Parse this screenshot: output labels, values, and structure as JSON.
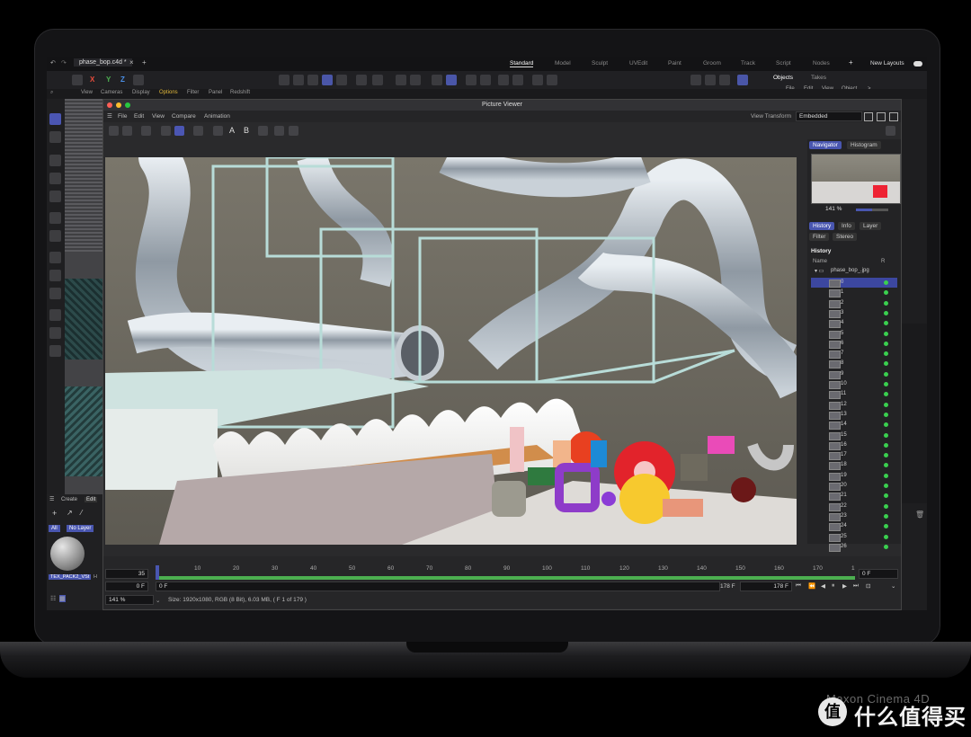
{
  "window": {
    "doc_tab": "phase_bop.c4d *",
    "new_tab": "+",
    "layouts": [
      "Standard",
      "Model",
      "Sculpt",
      "UVEdit",
      "Paint",
      "Groom",
      "Track",
      "Script",
      "Nodes"
    ],
    "active_layout": "Standard",
    "plus": "+",
    "new_layouts": "New Layouts"
  },
  "viewport_menu": [
    "View",
    "Cameras",
    "Display",
    "Options",
    "Filter",
    "Panel",
    "Redshift"
  ],
  "objects_panel": {
    "tabs": [
      "Objects",
      "Takes"
    ],
    "menu": [
      "File",
      "Edit",
      "View",
      "Object",
      ">"
    ]
  },
  "material_panel": {
    "tabs": [
      "Create",
      "Edit"
    ],
    "filters": [
      "All",
      "No Layer"
    ],
    "material_name": "TEX_PACK2_VSt",
    "extra": "H"
  },
  "picture_viewer": {
    "title": "Picture Viewer",
    "menu": [
      "File",
      "Edit",
      "View",
      "Compare",
      "Animation"
    ],
    "view_transform_label": "View Transform",
    "view_transform_value": "Embedded",
    "tool_letters": [
      "A",
      "B"
    ],
    "nav_tabs": [
      "Navigator",
      "Histogram"
    ],
    "zoom": "141 %",
    "info_tabs": [
      "History",
      "Info",
      "Layer"
    ],
    "info_tabs2": [
      "Filter",
      "Stereo"
    ],
    "history_heading": "History",
    "history_col_name": "Name",
    "history_col_r": "R",
    "history_root": "phase_bop_.jpg",
    "history_items": [
      "0",
      "1",
      "2",
      "3",
      "4",
      "5",
      "6",
      "7",
      "8",
      "9",
      "10",
      "11",
      "12",
      "13",
      "14",
      "15",
      "16",
      "17",
      "18",
      "19",
      "20",
      "21",
      "22",
      "23",
      "24",
      "25",
      "26"
    ],
    "status": "Size: 1920x1080, RGB (8 Bit), 6.03 MB, ( F 1 of 179 )",
    "status_zoom": "141 %"
  },
  "timeline": {
    "current_frame": "35",
    "start_frame": "0 F",
    "start_frame2": "0 F",
    "end_frame_field": "0 F",
    "end_a": "178 F",
    "end_b": "178 F",
    "ticks": [
      "0",
      "10",
      "20",
      "30",
      "40",
      "50",
      "60",
      "70",
      "80",
      "90",
      "100",
      "110",
      "120",
      "130",
      "140",
      "150",
      "160",
      "170",
      "1"
    ]
  },
  "caption": "Maxon Cinema 4D",
  "watermark": {
    "badge": "值",
    "text": "什么值得买"
  },
  "colors": {
    "accent": "#4956b0",
    "green": "#3ad04f",
    "render_wall": "#6f6b61"
  }
}
